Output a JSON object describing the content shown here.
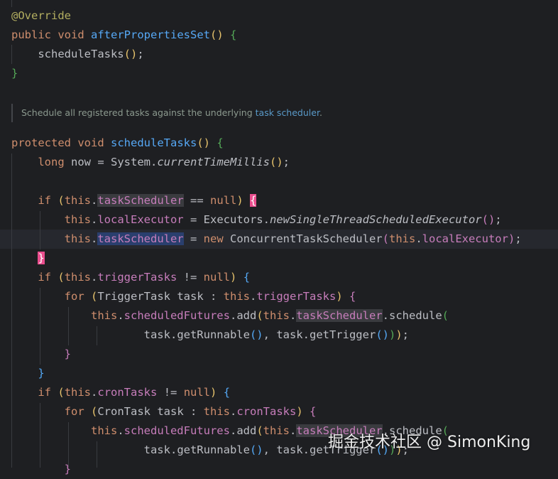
{
  "doc_comment": {
    "text": "Schedule all registered tasks against the underlying ",
    "link": "task scheduler",
    "end": "."
  },
  "tokens": {
    "override": "@Override",
    "public": "public",
    "void": "void",
    "protected": "protected",
    "long": "long",
    "if": "if",
    "for": "for",
    "this": "this",
    "null": "null",
    "new": "new",
    "after_properties_set": "afterPropertiesSet",
    "schedule_tasks": "scheduleTasks",
    "now": "now",
    "system": "System",
    "current_time_millis": "currentTimeMillis",
    "task_scheduler": "taskScheduler",
    "local_executor": "localExecutor",
    "executors": "Executors",
    "new_single_thread": "newSingleThreadScheduledExecutor",
    "concurrent_task_scheduler": "ConcurrentTaskScheduler",
    "trigger_tasks": "triggerTasks",
    "trigger_task": "TriggerTask",
    "task": "task",
    "scheduled_futures": "scheduledFutures",
    "add": "add",
    "schedule": "schedule",
    "get_runnable": "getRunnable",
    "get_trigger": "getTrigger",
    "cron_tasks": "cronTasks",
    "cron_task": "CronTask"
  },
  "watermark": "掘金技术社区 @ SimonKing",
  "colors": {
    "background": "#1e1f22",
    "keyword": "#cf8e6d",
    "function": "#56a8f5",
    "field": "#c77dbb",
    "annotation": "#b3ae60"
  }
}
